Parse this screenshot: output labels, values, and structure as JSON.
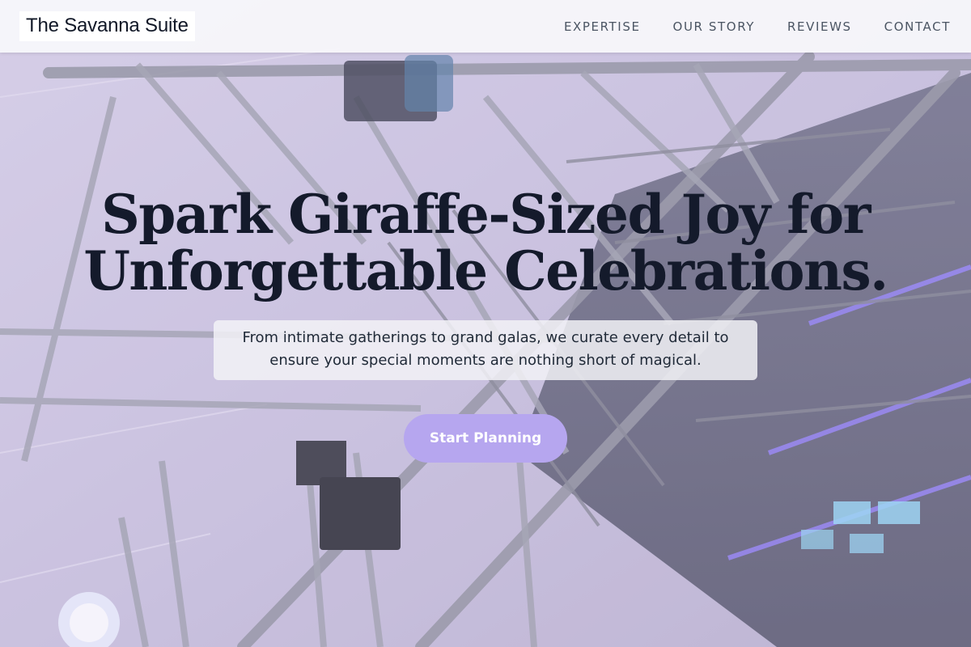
{
  "header": {
    "brand": "The Savanna Suite",
    "nav": [
      {
        "label": "EXPERTISE"
      },
      {
        "label": "OUR STORY"
      },
      {
        "label": "REVIEWS"
      },
      {
        "label": "CONTACT"
      }
    ]
  },
  "hero": {
    "title_line1": "Spark Giraffe-Sized Joy for",
    "title_line2": "Unforgettable Celebrations.",
    "subtitle": "From intimate gatherings to grand galas, we curate every detail to ensure your special moments are nothing short of magical.",
    "cta_label": "Start Planning"
  },
  "colors": {
    "cta": "#b6a6ef",
    "title": "#141a2b",
    "header_bg": "#f8f8fb"
  }
}
